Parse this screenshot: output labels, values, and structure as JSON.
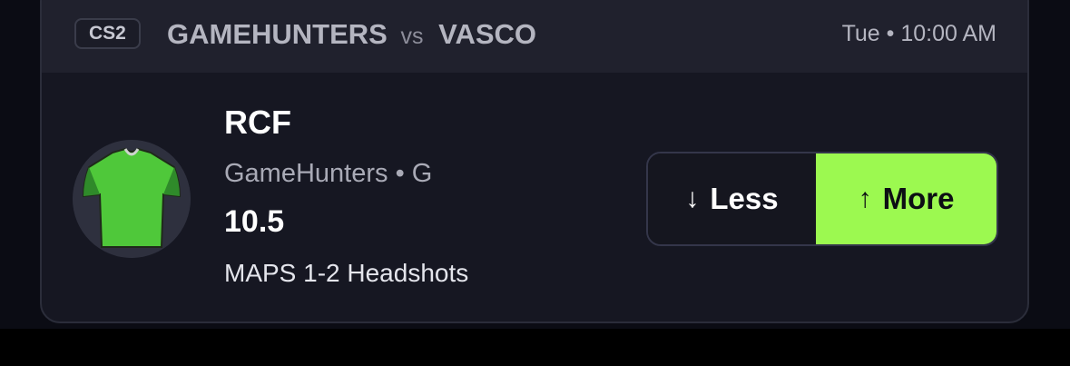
{
  "header": {
    "game_badge": "CS2",
    "team_home": "GAMEHUNTERS",
    "vs_label": "vs",
    "team_away": "VASCO",
    "time": "Tue • 10:00 AM"
  },
  "player": {
    "name": "RCF",
    "team_position": "GameHunters • G",
    "line": "10.5",
    "stat": "MAPS 1-2 Headshots",
    "avatar_icon": "jersey-icon",
    "jersey_color": "#4fc83a"
  },
  "pick": {
    "less_label": "Less",
    "less_icon": "arrow-down-icon",
    "more_label": "More",
    "more_icon": "arrow-up-icon",
    "selected": "More",
    "accent_color": "#9cf950"
  }
}
